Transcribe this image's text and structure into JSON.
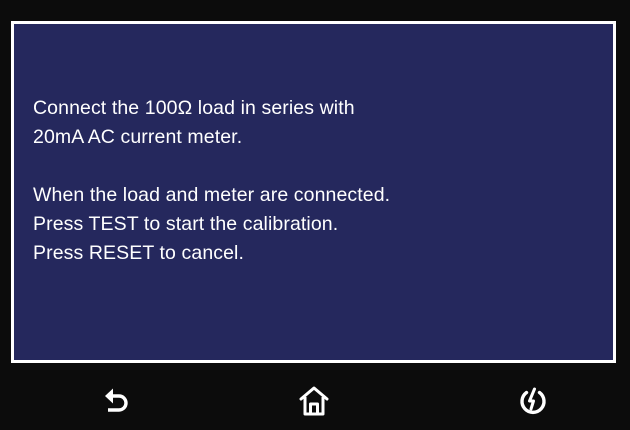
{
  "dialog": {
    "lines": [
      "Connect the 100Ω load in series with",
      "20mA AC current meter.",
      "",
      "When the load and meter are connected.",
      "Press TEST to start the calibration.",
      "Press RESET to cancel."
    ]
  },
  "nav": {
    "back_icon": "back-arrow-icon",
    "home_icon": "home-icon",
    "power_icon": "power-icon"
  },
  "colors": {
    "panel_background": "#25285d",
    "panel_border": "#ffffff",
    "screen_background": "#0c0c0c",
    "text": "#ffffff"
  }
}
